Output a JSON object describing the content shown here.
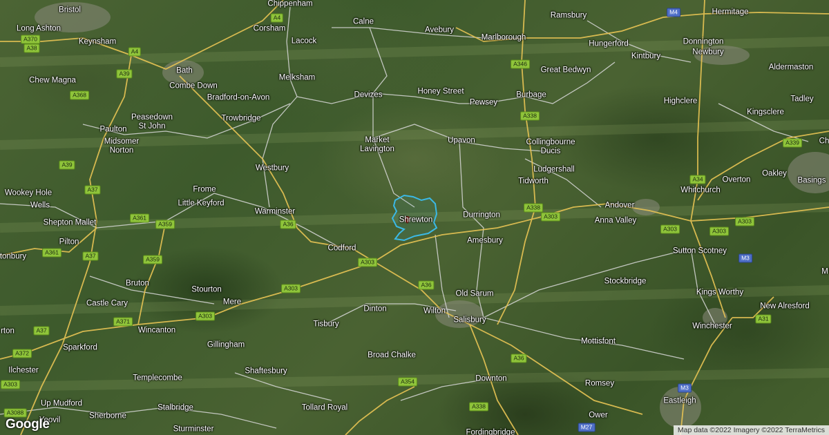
{
  "logo": "Google",
  "attribution": "Map data ©2022 Imagery ©2022 TerraMetrics",
  "colors": {
    "road_major": "#e8c454",
    "road_minor": "#d9d9d9",
    "boundary": "#3bb9e6",
    "shield_a": "#8fc43a",
    "shield_m": "#4f6fc7"
  },
  "places": [
    {
      "id": "bristol",
      "label": "Bristol"
    },
    {
      "id": "chippenham",
      "label": "Chippenham"
    },
    {
      "id": "ramsbury",
      "label": "Ramsbury"
    },
    {
      "id": "hermitage",
      "label": "Hermitage"
    },
    {
      "id": "long-ashton",
      "label": "Long Ashton"
    },
    {
      "id": "corsham",
      "label": "Corsham"
    },
    {
      "id": "calne",
      "label": "Calne"
    },
    {
      "id": "avebury",
      "label": "Avebury"
    },
    {
      "id": "marlborough",
      "label": "Marlborough"
    },
    {
      "id": "donnington",
      "label": "Donnington"
    },
    {
      "id": "keynsham",
      "label": "Keynsham"
    },
    {
      "id": "lacock",
      "label": "Lacock"
    },
    {
      "id": "hungerford",
      "label": "Hungerford"
    },
    {
      "id": "newbury",
      "label": "Newbury"
    },
    {
      "id": "kintbury",
      "label": "Kintbury"
    },
    {
      "id": "bath",
      "label": "Bath"
    },
    {
      "id": "aldermaston",
      "label": "Aldermaston"
    },
    {
      "id": "great-bedwyn",
      "label": "Great Bedwyn"
    },
    {
      "id": "chew-magna",
      "label": "Chew Magna"
    },
    {
      "id": "melksham",
      "label": "Melksham"
    },
    {
      "id": "combe-down",
      "label": "Combe Down"
    },
    {
      "id": "honey-street",
      "label": "Honey Street"
    },
    {
      "id": "devizes",
      "label": "Devizes"
    },
    {
      "id": "bradford-on-avon",
      "label": "Bradford-on-Avon"
    },
    {
      "id": "burbage",
      "label": "Burbage"
    },
    {
      "id": "tadley",
      "label": "Tadley"
    },
    {
      "id": "pewsey",
      "label": "Pewsey"
    },
    {
      "id": "highclere",
      "label": "Highclere"
    },
    {
      "id": "kingsclere",
      "label": "Kingsclere"
    },
    {
      "id": "peasedown",
      "label": "Peasedown\nSt John"
    },
    {
      "id": "trowbridge",
      "label": "Trowbridge"
    },
    {
      "id": "paulton",
      "label": "Paulton"
    },
    {
      "id": "upavon",
      "label": "Upavon"
    },
    {
      "id": "market-lavington",
      "label": "Market\nLavington"
    },
    {
      "id": "midsomer-norton",
      "label": "Midsomer\nNorton"
    },
    {
      "id": "collingbourne",
      "label": "Collingbourne\nDucis"
    },
    {
      "id": "westbury",
      "label": "Westbury"
    },
    {
      "id": "ludgershall",
      "label": "Ludgershall"
    },
    {
      "id": "oakley",
      "label": "Oakley"
    },
    {
      "id": "overton",
      "label": "Overton"
    },
    {
      "id": "tidworth",
      "label": "Tidworth"
    },
    {
      "id": "whitchurch",
      "label": "Whitchurch"
    },
    {
      "id": "basings",
      "label": "Basings"
    },
    {
      "id": "frome",
      "label": "Frome"
    },
    {
      "id": "wookey-hole",
      "label": "Wookey Hole"
    },
    {
      "id": "wells",
      "label": "Wells"
    },
    {
      "id": "little-keyford",
      "label": "Little Keyford"
    },
    {
      "id": "andover",
      "label": "Andover"
    },
    {
      "id": "warminster",
      "label": "Warminster"
    },
    {
      "id": "durrington",
      "label": "Durrington"
    },
    {
      "id": "shepton-mallet",
      "label": "Shepton Mallet"
    },
    {
      "id": "shrewton",
      "label": "Shrewton"
    },
    {
      "id": "anna-valley",
      "label": "Anna Valley"
    },
    {
      "id": "pilton",
      "label": "Pilton"
    },
    {
      "id": "amesbury",
      "label": "Amesbury"
    },
    {
      "id": "codford",
      "label": "Codford"
    },
    {
      "id": "sutton-scotney",
      "label": "Sutton Scotney"
    },
    {
      "id": "glastonbury",
      "label": "tonbury"
    },
    {
      "id": "bruton",
      "label": "Bruton"
    },
    {
      "id": "stockbridge",
      "label": "Stockbridge"
    },
    {
      "id": "stourton",
      "label": "Stourton"
    },
    {
      "id": "old-sarum",
      "label": "Old Sarum"
    },
    {
      "id": "kings-worthy",
      "label": "Kings Worthy"
    },
    {
      "id": "castle-cary",
      "label": "Castle Cary"
    },
    {
      "id": "mere",
      "label": "Mere"
    },
    {
      "id": "dinton",
      "label": "Dinton"
    },
    {
      "id": "wilton",
      "label": "Wilton"
    },
    {
      "id": "new-alresford",
      "label": "New Alresford"
    },
    {
      "id": "salisbury",
      "label": "Salisbury"
    },
    {
      "id": "tisbury",
      "label": "Tisbury"
    },
    {
      "id": "winchester",
      "label": "Winchester"
    },
    {
      "id": "wincanton",
      "label": "Wincanton"
    },
    {
      "id": "somerton",
      "label": "rton"
    },
    {
      "id": "gillingham",
      "label": "Gillingham"
    },
    {
      "id": "sparkford",
      "label": "Sparkford"
    },
    {
      "id": "mottisfont",
      "label": "Mottisfont"
    },
    {
      "id": "broad-chalke",
      "label": "Broad Chalke"
    },
    {
      "id": "ilchester",
      "label": "Ilchester"
    },
    {
      "id": "shaftesbury",
      "label": "Shaftesbury"
    },
    {
      "id": "templecombe",
      "label": "Templecombe"
    },
    {
      "id": "downton",
      "label": "Downton"
    },
    {
      "id": "romsey",
      "label": "Romsey"
    },
    {
      "id": "up-mudford",
      "label": "Up Mudford"
    },
    {
      "id": "eastleigh",
      "label": "Eastleigh"
    },
    {
      "id": "stalbridge",
      "label": "Stalbridge"
    },
    {
      "id": "tollard-royal",
      "label": "Tollard Royal"
    },
    {
      "id": "sherborne",
      "label": "Sherborne"
    },
    {
      "id": "ower",
      "label": "Ower"
    },
    {
      "id": "yeovil",
      "label": "Yeovil"
    },
    {
      "id": "sturminster",
      "label": "Sturminster"
    },
    {
      "id": "fordingbridge",
      "label": "Fordingbridge"
    },
    {
      "id": "edge-m",
      "label": "M"
    },
    {
      "id": "edge-ch",
      "label": "Ch"
    }
  ],
  "road_shields": [
    {
      "id": "a4-n",
      "label": "A4",
      "type": "a"
    },
    {
      "id": "m4",
      "label": "M4",
      "type": "m"
    },
    {
      "id": "a370",
      "label": "A370",
      "type": "a"
    },
    {
      "id": "a38",
      "label": "A38",
      "type": "a"
    },
    {
      "id": "a4-w",
      "label": "A4",
      "type": "a"
    },
    {
      "id": "a39-n",
      "label": "A39",
      "type": "a"
    },
    {
      "id": "a346",
      "label": "A346",
      "type": "a"
    },
    {
      "id": "a368",
      "label": "A368",
      "type": "a"
    },
    {
      "id": "a338-n",
      "label": "A338",
      "type": "a"
    },
    {
      "id": "a339",
      "label": "A339",
      "type": "a"
    },
    {
      "id": "a39-s",
      "label": "A39",
      "type": "a"
    },
    {
      "id": "a34",
      "label": "A34",
      "type": "a"
    },
    {
      "id": "a37-n",
      "label": "A37",
      "type": "a"
    },
    {
      "id": "a338-m",
      "label": "A338",
      "type": "a"
    },
    {
      "id": "a303-e1",
      "label": "A303",
      "type": "a"
    },
    {
      "id": "a361-n",
      "label": "A361",
      "type": "a"
    },
    {
      "id": "a359-n",
      "label": "A359",
      "type": "a"
    },
    {
      "id": "a36-n",
      "label": "A36",
      "type": "a"
    },
    {
      "id": "a303-e2",
      "label": "A303",
      "type": "a"
    },
    {
      "id": "a303-e3",
      "label": "A303",
      "type": "a"
    },
    {
      "id": "a303-e4",
      "label": "A303",
      "type": "a"
    },
    {
      "id": "a361-s",
      "label": "A361",
      "type": "a"
    },
    {
      "id": "a37-m",
      "label": "A37",
      "type": "a"
    },
    {
      "id": "m3-n",
      "label": "M3",
      "type": "m"
    },
    {
      "id": "a359-s",
      "label": "A359",
      "type": "a"
    },
    {
      "id": "a303-w1",
      "label": "A303",
      "type": "a"
    },
    {
      "id": "a36-m",
      "label": "A36",
      "type": "a"
    },
    {
      "id": "a303-w2",
      "label": "A303",
      "type": "a"
    },
    {
      "id": "a303-w3",
      "label": "A303",
      "type": "a"
    },
    {
      "id": "a371",
      "label": "A371",
      "type": "a"
    },
    {
      "id": "a31",
      "label": "A31",
      "type": "a"
    },
    {
      "id": "a37-s",
      "label": "A37",
      "type": "a"
    },
    {
      "id": "a372",
      "label": "A372",
      "type": "a"
    },
    {
      "id": "a36-s",
      "label": "A36",
      "type": "a"
    },
    {
      "id": "a354",
      "label": "A354",
      "type": "a"
    },
    {
      "id": "a303-sw",
      "label": "A303",
      "type": "a"
    },
    {
      "id": "m3-s",
      "label": "M3",
      "type": "m"
    },
    {
      "id": "a338-s",
      "label": "A338",
      "type": "a"
    },
    {
      "id": "a3088",
      "label": "A3088",
      "type": "a"
    },
    {
      "id": "m27",
      "label": "M27",
      "type": "m"
    }
  ]
}
